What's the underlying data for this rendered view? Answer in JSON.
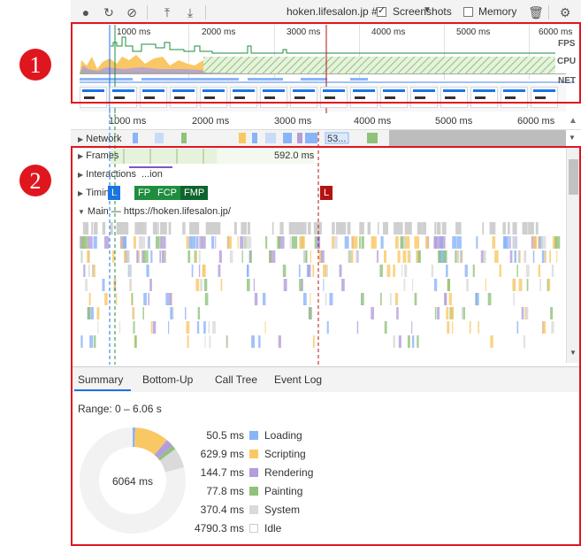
{
  "toolbar": {
    "record_icon": "record-icon",
    "reload_icon": "reload-icon",
    "clear_icon": "clear-icon",
    "upload_icon": "upload-icon",
    "download_icon": "download-icon",
    "profile": "hoken.lifesalon.jp #2",
    "screenshots_label": "Screenshots",
    "screenshots_checked": true,
    "memory_label": "Memory",
    "memory_checked": false,
    "trash_icon": "trash-icon",
    "settings_icon": "gear-icon"
  },
  "overview": {
    "ticks": [
      "1000 ms",
      "2000 ms",
      "3000 ms",
      "4000 ms",
      "5000 ms",
      "6000 ms"
    ],
    "labels": {
      "fps": "FPS",
      "cpu": "CPU",
      "net": "NET"
    }
  },
  "ruler": {
    "ticks": [
      "1000 ms",
      "2000 ms",
      "3000 ms",
      "4000 ms",
      "5000 ms",
      "6000 ms"
    ]
  },
  "tracks": {
    "network": "Network",
    "network_item": "53...",
    "frames": "Frames",
    "frames_time": "592.0 ms",
    "interactions": "Interactions",
    "interactions_item": "...ion",
    "timings": "Timings",
    "main": "Main — https://hoken.lifesalon.jp/"
  },
  "timings_chips": [
    {
      "label": "L",
      "color": "#1a73e8"
    },
    {
      "label": "FP",
      "color": "#1e8e3e"
    },
    {
      "label": "FCP",
      "color": "#1e8e3e"
    },
    {
      "label": "FMP",
      "color": "#0d652d"
    },
    {
      "label": "L",
      "color": "#b31412"
    }
  ],
  "tabs": [
    "Summary",
    "Bottom-Up",
    "Call Tree",
    "Event Log"
  ],
  "active_tab": "Summary",
  "summary": {
    "range": "Range: 0 – 6.06 s",
    "total": "6064 ms",
    "items": [
      {
        "value": "50.5 ms",
        "name": "Loading",
        "color": "#8ab4f8"
      },
      {
        "value": "629.9 ms",
        "name": "Scripting",
        "color": "#f9c864"
      },
      {
        "value": "144.7 ms",
        "name": "Rendering",
        "color": "#b39ddb"
      },
      {
        "value": "77.8 ms",
        "name": "Painting",
        "color": "#8fc27a"
      },
      {
        "value": "370.4 ms",
        "name": "System",
        "color": "#dadada"
      },
      {
        "value": "4790.3 ms",
        "name": "Idle",
        "color": "#ffffff"
      }
    ]
  },
  "annotations": [
    "1",
    "2"
  ]
}
